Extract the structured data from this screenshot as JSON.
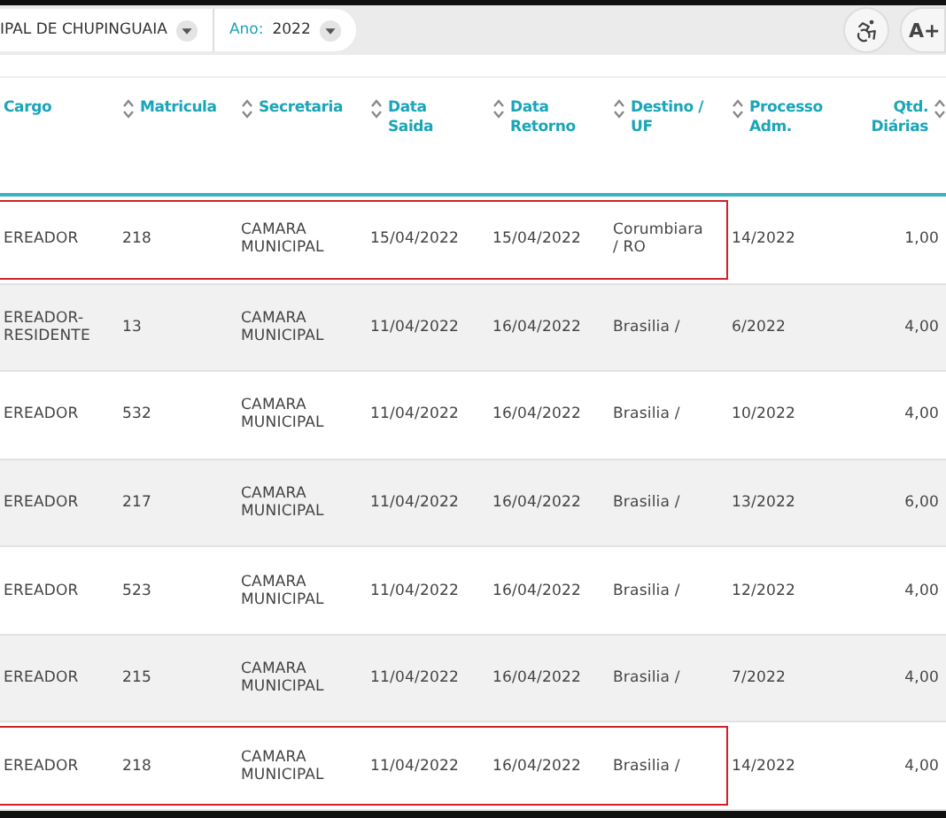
{
  "toolbar": {
    "entity_filter": {
      "value": "IPAL DE CHUPINGUAIA"
    },
    "year_filter": {
      "label": "Ano:",
      "value": "2022"
    },
    "font_button": {
      "label": "A+"
    }
  },
  "table": {
    "columns": [
      {
        "label": "Cargo",
        "sort_icon": false
      },
      {
        "label": "Matricula",
        "sort_icon": true
      },
      {
        "label": "Secretaria",
        "sort_icon": true
      },
      {
        "label": "Data Saida",
        "sort_icon": true
      },
      {
        "label": "Data Retorno",
        "sort_icon": true
      },
      {
        "label": "Destino / UF",
        "sort_icon": true
      },
      {
        "label": "Processo Adm.",
        "sort_icon": true
      },
      {
        "label": "Qtd. Diárias",
        "sort_icon": true
      }
    ],
    "rows": [
      {
        "highlighted": true,
        "cells": [
          "EREADOR",
          "218",
          "CAMARA MUNICIPAL",
          "15/04/2022",
          "15/04/2022",
          "Corumbiara / RO",
          "14/2022",
          "1,00"
        ]
      },
      {
        "highlighted": false,
        "cells": [
          "EREADOR-RESIDENTE",
          "13",
          "CAMARA MUNICIPAL",
          "11/04/2022",
          "16/04/2022",
          "Brasilia /",
          "6/2022",
          "4,00"
        ]
      },
      {
        "highlighted": false,
        "cells": [
          "EREADOR",
          "532",
          "CAMARA MUNICIPAL",
          "11/04/2022",
          "16/04/2022",
          "Brasilia /",
          "10/2022",
          "4,00"
        ]
      },
      {
        "highlighted": false,
        "cells": [
          "EREADOR",
          "217",
          "CAMARA MUNICIPAL",
          "11/04/2022",
          "16/04/2022",
          "Brasilia /",
          "13/2022",
          "6,00"
        ]
      },
      {
        "highlighted": false,
        "cells": [
          "EREADOR",
          "523",
          "CAMARA MUNICIPAL",
          "11/04/2022",
          "16/04/2022",
          "Brasilia /",
          "12/2022",
          "4,00"
        ]
      },
      {
        "highlighted": false,
        "cells": [
          "EREADOR",
          "215",
          "CAMARA MUNICIPAL",
          "11/04/2022",
          "16/04/2022",
          "Brasilia /",
          "7/2022",
          "4,00"
        ]
      },
      {
        "highlighted": true,
        "cells": [
          "EREADOR",
          "218",
          "CAMARA MUNICIPAL",
          "11/04/2022",
          "16/04/2022",
          "Brasilia /",
          "14/2022",
          "4,00"
        ]
      }
    ]
  }
}
